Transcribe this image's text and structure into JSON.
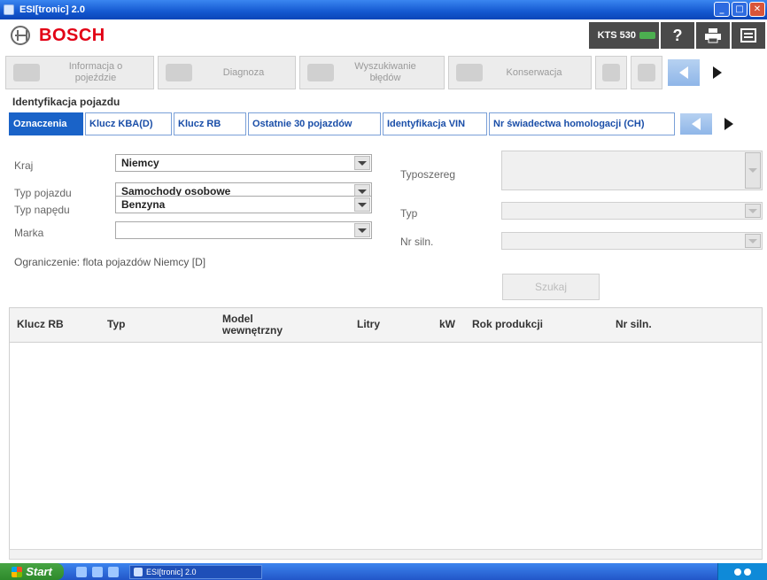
{
  "window": {
    "title": "ESI[tronic] 2.0"
  },
  "header": {
    "brand": "BOSCH",
    "device": "KTS 530",
    "help_label": "?",
    "print_icon": "printer-icon",
    "menu_icon": "menu-icon"
  },
  "nav": {
    "tabs": [
      {
        "label": "Informacja o pojeździe",
        "icon": "car-icon"
      },
      {
        "label": "Diagnoza",
        "icon": "diagnosis-icon"
      },
      {
        "label": "Wyszukiwanie błędów",
        "icon": "troubleshooting-icon"
      },
      {
        "label": "Konserwacja",
        "icon": "maintenance-icon"
      }
    ]
  },
  "page": {
    "section_title": "Identyfikacja pojazdu"
  },
  "subtabs": [
    {
      "label": "Oznaczenia",
      "active": true
    },
    {
      "label": "Klucz KBA(D)",
      "active": false
    },
    {
      "label": "Klucz RB",
      "active": false
    },
    {
      "label": "Ostatnie 30 pojazdów",
      "active": false
    },
    {
      "label": "Identyfikacja VIN",
      "active": false
    },
    {
      "label": "Nr świadectwa homologacji (CH)",
      "active": false
    }
  ],
  "form": {
    "kraj": {
      "label": "Kraj",
      "value": "Niemcy"
    },
    "typ_pojazdu": {
      "label": "Typ pojazdu",
      "value": "Samochody osobowe"
    },
    "typ_napedu": {
      "label": "Typ napędu",
      "value": "Benzyna"
    },
    "marka": {
      "label": "Marka",
      "value": ""
    },
    "typoszereg": {
      "label": "Typoszereg",
      "value": ""
    },
    "typ": {
      "label": "Typ",
      "value": ""
    },
    "nr_silnika": {
      "label": "Nr siln.",
      "value": ""
    },
    "restriction": "Ograniczenie: flota pojazdów Niemcy [D]",
    "search_label": "Szukaj"
  },
  "table": {
    "columns": [
      "Klucz RB",
      "Typ",
      "Model wewnętrzny",
      "Litry",
      "kW",
      "Rok produkcji",
      "Nr siln."
    ],
    "rows": []
  },
  "taskbar": {
    "start_label": "Start",
    "task_label": "ESI[tronic] 2.0"
  },
  "colors": {
    "brand_red": "#e20015",
    "active_tab": "#1a63c8",
    "titlebar": "#1458d0"
  }
}
